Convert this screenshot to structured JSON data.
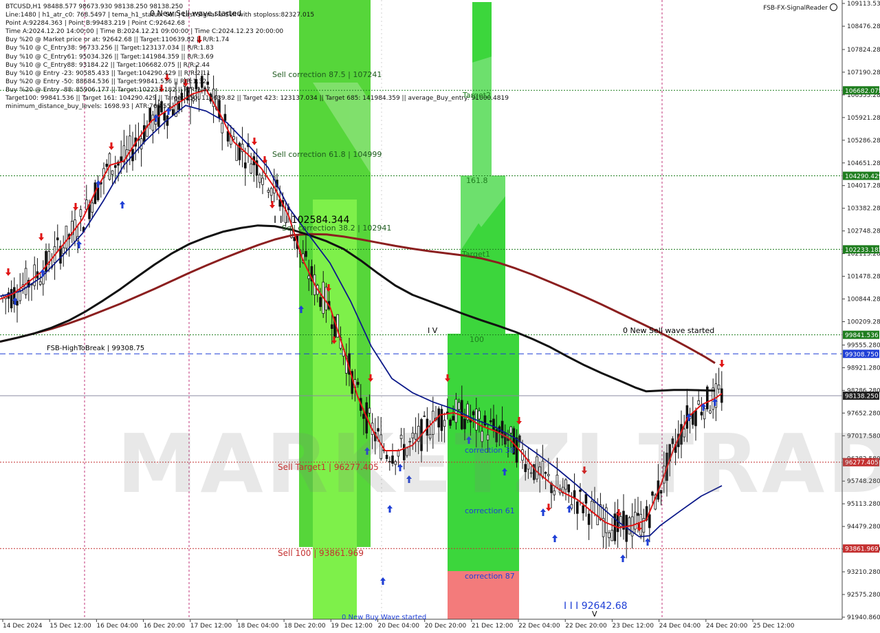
{
  "info_lines": [
    "BTCUSD,H1  98488.577 98673.930 98138.250 98138.250",
    "Line:1480 | h1_atr_c0: 768.5497 | tema_h1_status: Sell | Last Signal is:Sell with stoploss:82327.015",
    "Point A:92284.363 | Point B:99483.219 | Point C:92642.68",
    "Time A:2024.12.20 14:00:00 | Time B:2024.12.21 09:00:00 | Time C:2024.12.23 20:00:00",
    "Buy %20 @ Market price or at: 92642.68 || Target:110639.82 || R/R:1.74",
    "Buy %10 @ C_Entry38: 96733.256 || Target:123137.034 || R/R:1.83",
    "Buy %10 @ C_Entry61: 95034.326 || Target:141984.359 || R/R:3.69",
    "Buy %10 @ C_Entry88: 93184.22 || Target:106682.075 || R/R:2.44",
    "Buy %10 @ Entry -23: 90585.433 || Target:104290.429 || R/R:2.11",
    "Buy %20 @ Entry -50: 88684.536 || Target:99841.536 || R/R:1.32",
    "Buy %20 @ Entry -88: 85906.177 || Target:102233.182 || R/R:1.47",
    "Target100: 99841.536 || Target 161: 104290.429 || Target 250: 110639.82 || Target 423: 123137.034 || Target 685: 141984.359 || average_Buy_entry: 91000.4819",
    "minimum_distance_buy_levels: 1698.93 | ATR:768.55"
  ],
  "brand": "FSB-FX-SignalReader",
  "watermark": "MARKETZI TRADE",
  "chart_data": {
    "type": "line",
    "symbol": "BTCUSD,H1",
    "ylim": [
      91940.86,
      109113.53
    ],
    "y_ticks": [
      "109113.530",
      "108476.280",
      "107824.280",
      "107190.280",
      "106555.280",
      "105921.280",
      "105286.280",
      "104651.280",
      "104017.280",
      "103382.280",
      "102748.280",
      "102113.280",
      "101478.280",
      "100844.280",
      "100209.280",
      "99555.280",
      "98921.280",
      "98286.280",
      "97652.280",
      "97017.580",
      "96382.580",
      "95748.280",
      "95113.280",
      "94479.280",
      "93844.280",
      "93210.280",
      "92575.280",
      "91940.860"
    ],
    "x_ticks": [
      "14 Dec 2024",
      "15 Dec 12:00",
      "16 Dec 04:00",
      "16 Dec 20:00",
      "17 Dec 12:00",
      "18 Dec 04:00",
      "18 Dec 20:00",
      "19 Dec 12:00",
      "20 Dec 04:00",
      "20 Dec 20:00",
      "21 Dec 12:00",
      "22 Dec 04:00",
      "22 Dec 20:00",
      "23 Dec 12:00",
      "24 Dec 04:00",
      "24 Dec 20:00",
      "25 Dec 12:00"
    ],
    "level_badges": [
      {
        "value": 106682.075,
        "label": "106682.075",
        "color": "#1e7d1e"
      },
      {
        "value": 104290.429,
        "label": "104290.429",
        "color": "#1e7d1e"
      },
      {
        "value": 102233.182,
        "label": "102233.182",
        "color": "#1e7d1e"
      },
      {
        "value": 99841.536,
        "label": "99841.536",
        "color": "#1e7d1e"
      },
      {
        "value": 99308.75,
        "label": "99308.750",
        "color": "#1f3fd6"
      },
      {
        "value": 98138.25,
        "label": "98138.250",
        "color": "#222222"
      },
      {
        "value": 96277.405,
        "label": "96277.405",
        "color": "#c43030"
      },
      {
        "value": 93861.969,
        "label": "93861.969",
        "color": "#c43030"
      }
    ],
    "close_price": 98138.25,
    "annotations": [
      {
        "text": "0 New Sell wave started",
        "color": "#111111"
      },
      {
        "text": "Sell correction 87.5 | 107241",
        "color": "#1e5a1e"
      },
      {
        "text": "Sell correction 61.8 | 104999",
        "color": "#1e5a1e"
      },
      {
        "text": "Sell correction 38.2 | 102941",
        "color": "#1e5a1e"
      },
      {
        "text": "I I I 102584.344",
        "color": "#111111"
      },
      {
        "text": "Target2",
        "color": "#1e7d1e"
      },
      {
        "text": "161.8",
        "color": "#1e7d1e"
      },
      {
        "text": "Target1",
        "color": "#1e7d1e"
      },
      {
        "text": "100",
        "color": "#1e7d1e"
      },
      {
        "text": "I V",
        "color": "#111111"
      },
      {
        "text": "0 New Sell wave started",
        "color": "#111111"
      },
      {
        "text": "FSB-HighToBreak | 99308.75",
        "color": "#111111"
      },
      {
        "text": "Sell Target1 | 96277.405",
        "color": "#c43030"
      },
      {
        "text": "Sell 100 | 93861.969",
        "color": "#c43030"
      },
      {
        "text": "correction 38",
        "color": "#1f3fd6"
      },
      {
        "text": "correction 61",
        "color": "#1f3fd6"
      },
      {
        "text": "correction 87",
        "color": "#1f3fd6"
      },
      {
        "text": "0 New Buy Wave started",
        "color": "#1f3fd6"
      },
      {
        "text": "I I I 92642.68",
        "color": "#1f3fd6"
      },
      {
        "text": "V",
        "color": "#111111"
      }
    ],
    "series": [
      {
        "name": "",
        "color": "#8b1f1f",
        "x": [
          0,
          25,
          50,
          75,
          100,
          125,
          150,
          175,
          200,
          225,
          250,
          275,
          300,
          325,
          350,
          375,
          400,
          425,
          450,
          475,
          500,
          525,
          550,
          575,
          600,
          625,
          650,
          675,
          700,
          725,
          750,
          775,
          800,
          825,
          850,
          875,
          900,
          925,
          950,
          975,
          1000,
          1025,
          1040
        ],
        "values": [
          99650,
          99760,
          99880,
          100010,
          100160,
          100330,
          100520,
          100710,
          100920,
          101130,
          101350,
          101570,
          101780,
          101980,
          102170,
          102350,
          102510,
          102630,
          102660,
          102650,
          102590,
          102510,
          102420,
          102330,
          102250,
          102180,
          102120,
          102060,
          101980,
          101860,
          101700,
          101520,
          101320,
          101120,
          100910,
          100690,
          100460,
          100230,
          100000,
          99760,
          99500,
          99230,
          99050
        ]
      },
      {
        "name": "",
        "color": "#111111",
        "x": [
          0,
          25,
          50,
          75,
          100,
          125,
          150,
          175,
          200,
          225,
          250,
          275,
          300,
          325,
          350,
          375,
          400,
          425,
          450,
          475,
          500,
          525,
          550,
          575,
          600,
          625,
          650,
          675,
          700,
          725,
          750,
          775,
          800,
          825,
          850,
          875,
          900,
          925,
          940,
          960,
          980,
          1000,
          1020,
          1040
        ],
        "values": [
          99650,
          99760,
          99880,
          100040,
          100240,
          100500,
          100800,
          101120,
          101470,
          101810,
          102120,
          102380,
          102570,
          102730,
          102830,
          102900,
          102880,
          102780,
          102630,
          102460,
          102240,
          101920,
          101560,
          101220,
          100960,
          100780,
          100600,
          100420,
          100250,
          100090,
          99920,
          99720,
          99500,
          99240,
          98990,
          98770,
          98570,
          98360,
          98260,
          98280,
          98300,
          98300,
          98290,
          98280
        ]
      },
      {
        "name": "",
        "color": "#0d1a8a",
        "x": [
          0,
          30,
          60,
          90,
          120,
          150,
          180,
          210,
          240,
          270,
          300,
          330,
          360,
          390,
          420,
          450,
          480,
          510,
          540,
          570,
          600,
          630,
          660,
          690,
          720,
          750,
          780,
          810,
          840,
          870,
          900,
          930,
          945,
          960,
          990,
          1020,
          1050
        ],
        "values": [
          100920,
          101060,
          101450,
          102040,
          102680,
          103580,
          104580,
          105240,
          105800,
          106260,
          106100,
          105780,
          105180,
          104520,
          103400,
          102620,
          101850,
          100780,
          99520,
          98620,
          98220,
          97960,
          97760,
          97480,
          97260,
          96940,
          96530,
          96100,
          95620,
          95100,
          94600,
          94190,
          94220,
          94500,
          94920,
          95330,
          95620
        ]
      },
      {
        "name": "",
        "color": "#e01414",
        "x": [
          0,
          20,
          40,
          60,
          80,
          100,
          120,
          140,
          160,
          180,
          200,
          220,
          240,
          260,
          280,
          300,
          320,
          340,
          360,
          380,
          400,
          420,
          440,
          460,
          480,
          500,
          520,
          540,
          560,
          580,
          600,
          620,
          640,
          660,
          680,
          700,
          720,
          740,
          760,
          780,
          800,
          820,
          840,
          860,
          880,
          900,
          920,
          940,
          960,
          980,
          1000,
          1020,
          1040,
          1050
        ],
        "values": [
          100840,
          101000,
          101300,
          101600,
          102080,
          102560,
          103080,
          103900,
          104590,
          104700,
          105300,
          105820,
          106080,
          106340,
          106580,
          106700,
          106020,
          105240,
          104900,
          104500,
          103940,
          103160,
          101960,
          101160,
          100620,
          99440,
          98120,
          97240,
          96600,
          96600,
          96750,
          97200,
          97600,
          97660,
          97530,
          97290,
          97150,
          96950,
          96520,
          96030,
          95700,
          95420,
          95230,
          94910,
          94600,
          94440,
          94510,
          94660,
          95590,
          96650,
          97520,
          97880,
          98060,
          98200
        ]
      }
    ]
  }
}
